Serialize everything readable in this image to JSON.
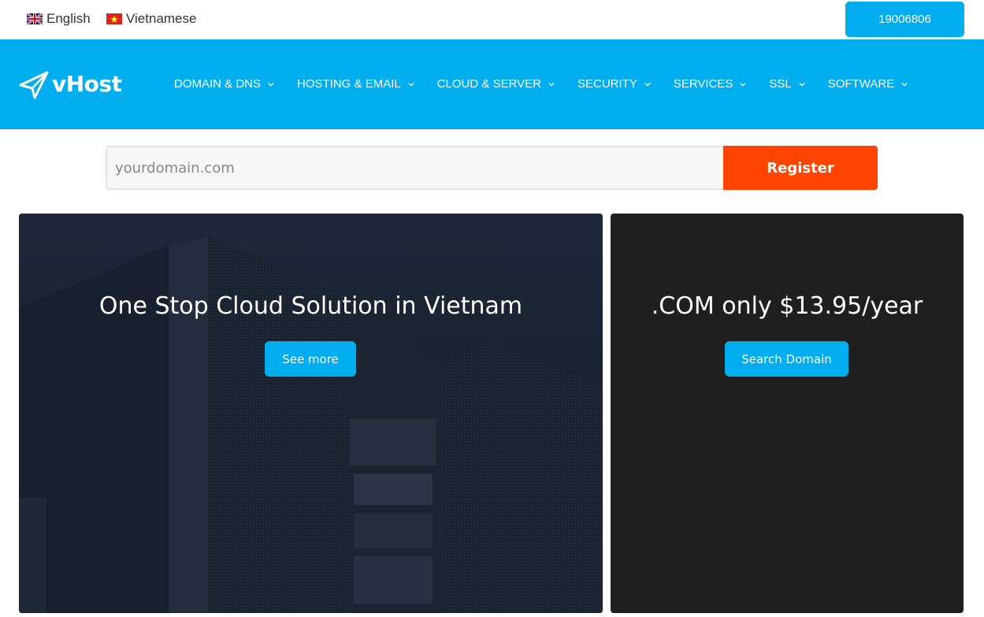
{
  "topbar": {
    "languages": [
      {
        "label": "English",
        "flag": "uk-flag-icon"
      },
      {
        "label": "Vietnamese",
        "flag": "vietnam-flag-icon"
      }
    ],
    "hotline": "19006806"
  },
  "header": {
    "logo_text": "vHost",
    "nav": [
      {
        "label": "DOMAIN & DNS"
      },
      {
        "label": "HOSTING & EMAIL"
      },
      {
        "label": "CLOUD & SERVER"
      },
      {
        "label": "SECURITY"
      },
      {
        "label": "SERVICES"
      },
      {
        "label": "SSL"
      },
      {
        "label": "SOFTWARE"
      }
    ]
  },
  "search": {
    "placeholder": "yourdomain.com",
    "value": "",
    "button_label": "Register"
  },
  "banners": {
    "left": {
      "title": "One Stop Cloud Solution in Vietnam",
      "button_label": "See more"
    },
    "right": {
      "title": ".COM only $13.95/year",
      "button_label": "Search Domain"
    }
  },
  "colors": {
    "brand": "#00aeef",
    "register": "#ff4300",
    "banner_left": "#1b2330",
    "banner_right": "#1f1f1f"
  }
}
